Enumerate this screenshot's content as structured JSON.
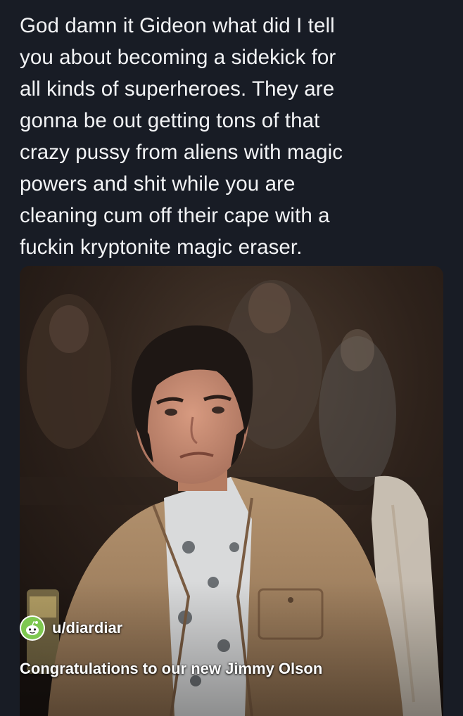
{
  "post": {
    "text_lines": [
      "God damn it Gideon what did I tell",
      "you about becoming a sidekick for",
      "all kinds of superheroes. They are",
      "gonna be out getting tons of that",
      "crazy pussy from aliens with magic",
      "powers and shit while you are",
      "cleaning cum off their cape with a",
      "fuckin kryptonite magic eraser."
    ]
  },
  "media": {
    "description_icon": "tv-still-photo",
    "overlay": {
      "username": "u/diardiar",
      "avatar_icon": "reddit-snoo-avatar-icon",
      "avatar_color": "#7ec850",
      "caption": "Congratulations to our new Jimmy Olson"
    }
  },
  "colors": {
    "background": "#181c25",
    "text": "#f2f3f5"
  }
}
